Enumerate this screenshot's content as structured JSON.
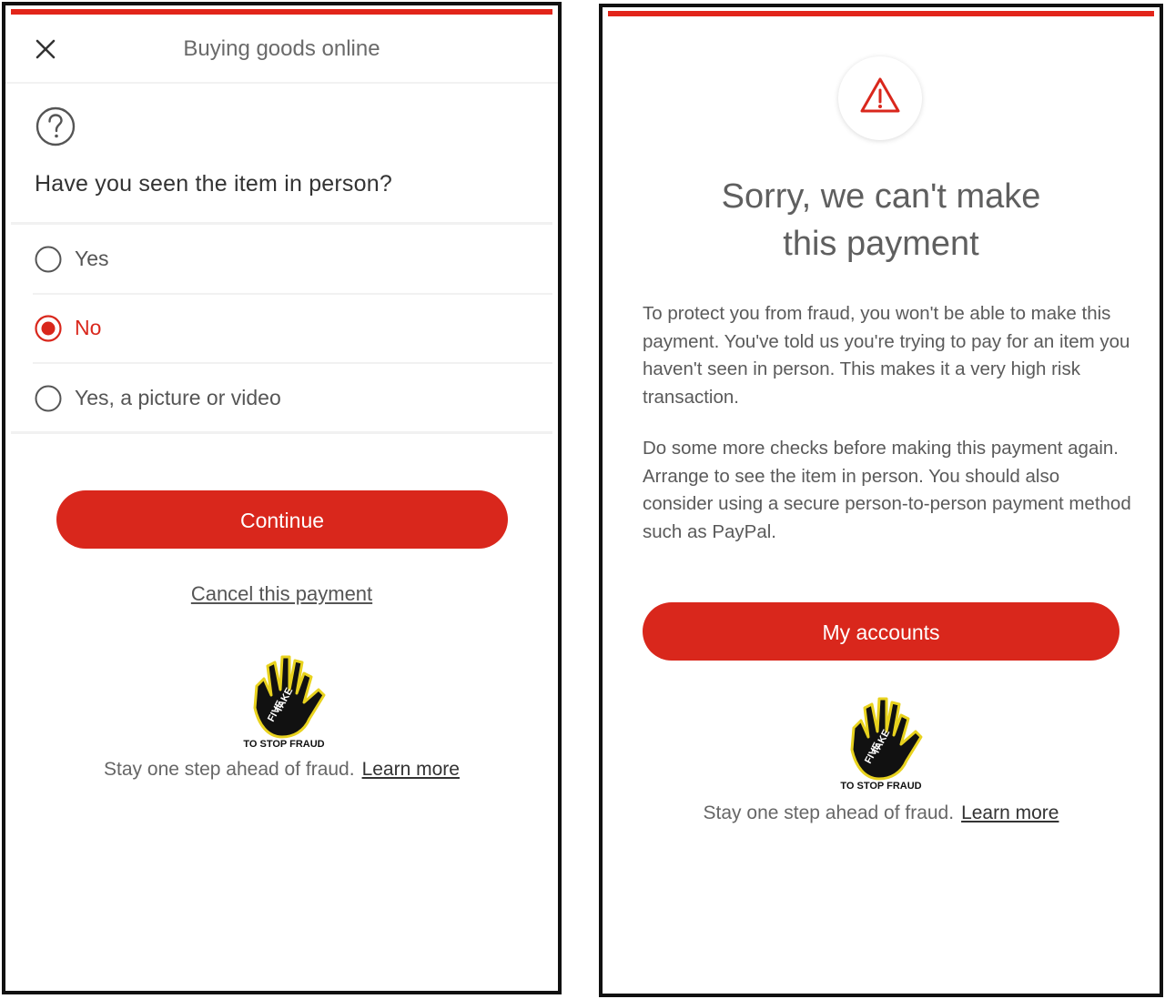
{
  "colors": {
    "brand_red": "#d9271c",
    "text_dark": "#333333",
    "text_muted": "#5a5a5a"
  },
  "left_screen": {
    "header": {
      "title": "Buying goods online",
      "close_icon": "close-icon"
    },
    "question_icon": "question-circle-icon",
    "question": "Have you seen the item in person?",
    "options": [
      {
        "label": "Yes",
        "selected": false
      },
      {
        "label": "No",
        "selected": true
      },
      {
        "label": "Yes, a picture or video",
        "selected": false
      }
    ],
    "continue_label": "Continue",
    "cancel_label": "Cancel this payment",
    "logo": {
      "name": "take-five-logo",
      "lettering": "TAKE FIVE TO STOP FRAUD"
    },
    "footer": {
      "text": "Stay one step ahead of fraud.",
      "link": "Learn more"
    }
  },
  "right_screen": {
    "warning_icon": "warning-triangle-icon",
    "title_line1": "Sorry, we can't make",
    "title_line2": "this payment",
    "paragraph1": "To protect you from fraud, you won't be able to make this payment. You've told us you're trying to pay for an item you haven't seen in person. This makes it a very high risk transaction.",
    "paragraph2": "Do some more checks before making this payment again. Arrange to see the item in person. You should also consider using a secure person-to-person payment method such as PayPal.",
    "accounts_label": "My accounts",
    "logo": {
      "name": "take-five-logo",
      "lettering": "TAKE FIVE TO STOP FRAUD"
    },
    "footer": {
      "text": "Stay one step ahead of fraud.",
      "link": "Learn more"
    }
  }
}
